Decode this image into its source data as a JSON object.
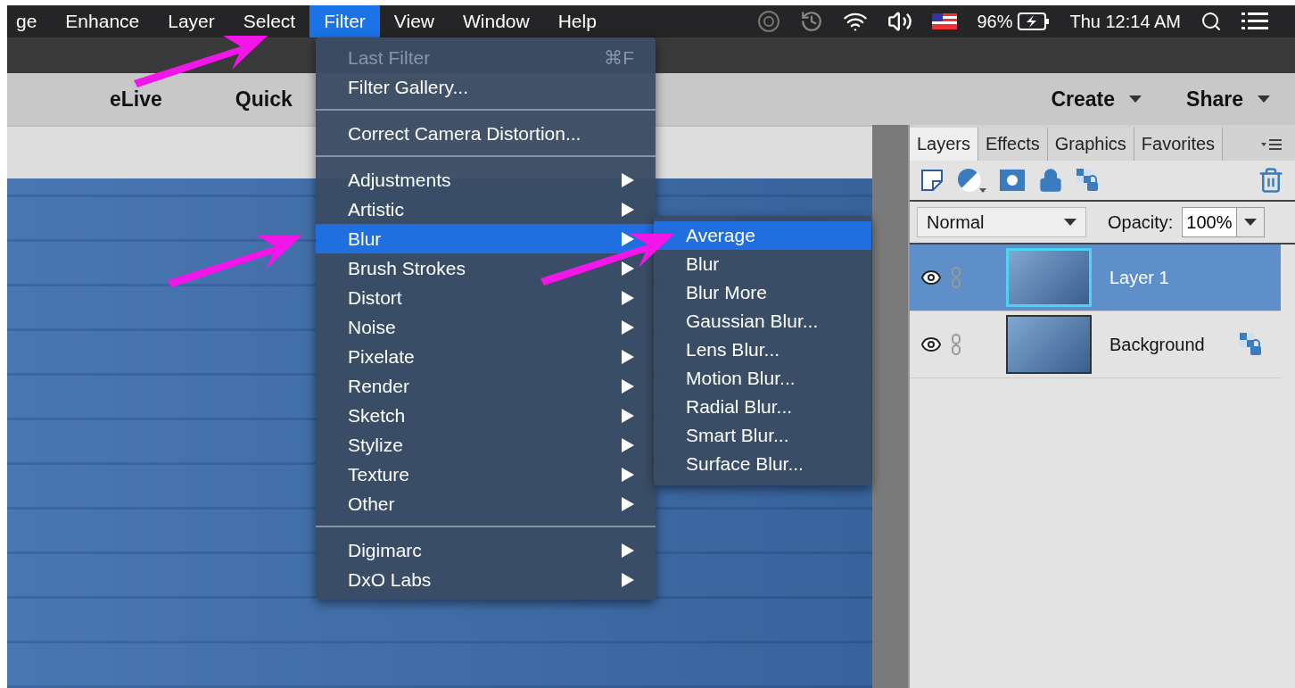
{
  "menubar": {
    "items": [
      {
        "label": "ge",
        "selected": false
      },
      {
        "label": "Enhance",
        "selected": false
      },
      {
        "label": "Layer",
        "selected": false
      },
      {
        "label": "Select",
        "selected": false
      },
      {
        "label": "Filter",
        "selected": true
      },
      {
        "label": "View",
        "selected": false
      },
      {
        "label": "Window",
        "selected": false
      },
      {
        "label": "Help",
        "selected": false
      }
    ],
    "battery": "96%",
    "clock": "Thu 12:14 AM"
  },
  "toolbar": {
    "modes": [
      "eLive",
      "Quick"
    ],
    "actions": [
      "Create",
      "Share"
    ]
  },
  "filter_menu": [
    {
      "kind": "item",
      "label": "Last Filter",
      "shortcut": "⌘F",
      "disabled": true
    },
    {
      "kind": "item",
      "label": "Filter Gallery...",
      "disabled": false
    },
    {
      "kind": "separator"
    },
    {
      "kind": "item",
      "label": "Correct Camera Distortion...",
      "disabled": false
    },
    {
      "kind": "separator"
    },
    {
      "kind": "submenu",
      "label": "Adjustments",
      "selected": false
    },
    {
      "kind": "submenu",
      "label": "Artistic",
      "selected": false
    },
    {
      "kind": "submenu",
      "label": "Blur",
      "selected": true
    },
    {
      "kind": "submenu",
      "label": "Brush Strokes",
      "selected": false
    },
    {
      "kind": "submenu",
      "label": "Distort",
      "selected": false
    },
    {
      "kind": "submenu",
      "label": "Noise",
      "selected": false
    },
    {
      "kind": "submenu",
      "label": "Pixelate",
      "selected": false
    },
    {
      "kind": "submenu",
      "label": "Render",
      "selected": false
    },
    {
      "kind": "submenu",
      "label": "Sketch",
      "selected": false
    },
    {
      "kind": "submenu",
      "label": "Stylize",
      "selected": false
    },
    {
      "kind": "submenu",
      "label": "Texture",
      "selected": false
    },
    {
      "kind": "submenu",
      "label": "Other",
      "selected": false
    },
    {
      "kind": "separator"
    },
    {
      "kind": "submenu",
      "label": "Digimarc",
      "selected": false
    },
    {
      "kind": "submenu",
      "label": "DxO Labs",
      "selected": false
    }
  ],
  "blur_submenu": [
    {
      "label": "Average",
      "selected": true
    },
    {
      "label": "Blur",
      "selected": false
    },
    {
      "label": "Blur More",
      "selected": false
    },
    {
      "label": "Gaussian Blur...",
      "selected": false
    },
    {
      "label": "Lens Blur...",
      "selected": false
    },
    {
      "label": "Motion Blur...",
      "selected": false
    },
    {
      "label": "Radial Blur...",
      "selected": false
    },
    {
      "label": "Smart Blur...",
      "selected": false
    },
    {
      "label": "Surface Blur...",
      "selected": false
    }
  ],
  "panel": {
    "tabs": [
      {
        "label": "Layers",
        "selected": true
      },
      {
        "label": "Effects",
        "selected": false
      },
      {
        "label": "Graphics",
        "selected": false
      },
      {
        "label": "Favorites",
        "selected": false
      }
    ],
    "blend_mode": "Normal",
    "opacity_label": "Opacity:",
    "opacity": "100%",
    "layers": [
      {
        "name": "Layer 1",
        "selected": true,
        "locked": false
      },
      {
        "name": "Background",
        "selected": false,
        "locked": true
      }
    ]
  }
}
